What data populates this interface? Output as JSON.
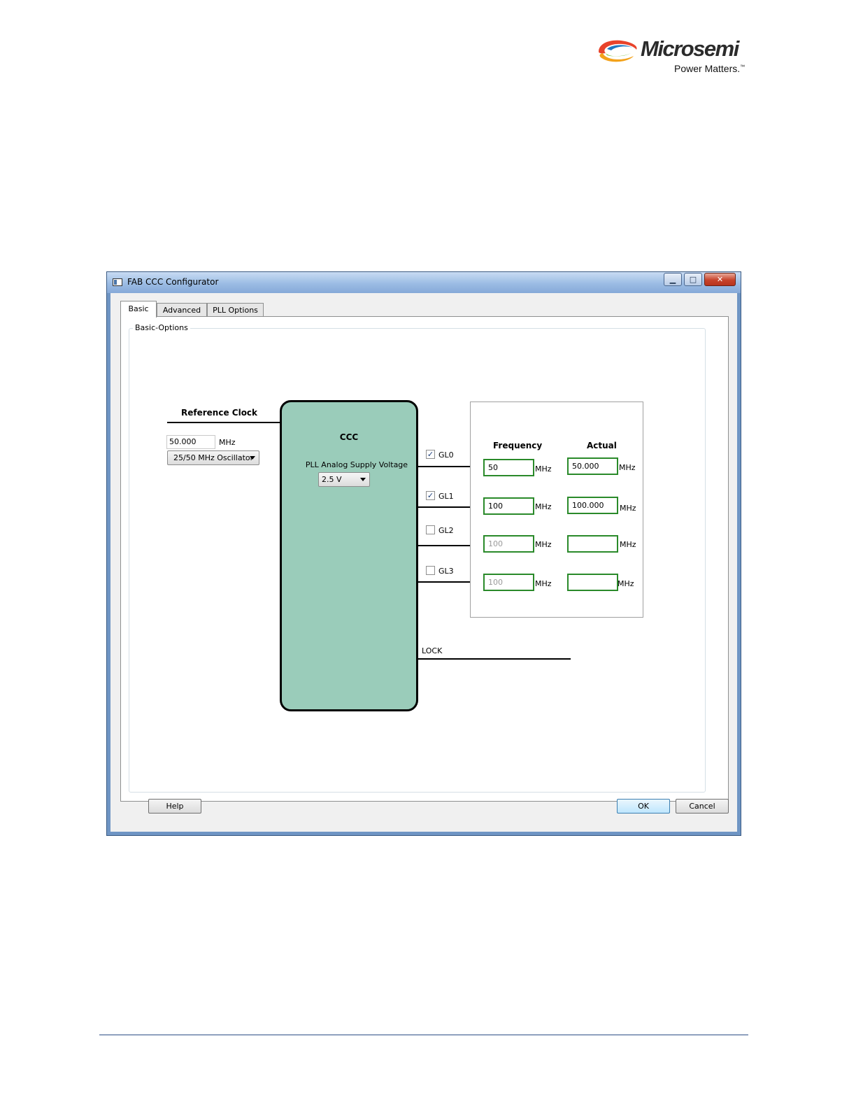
{
  "logo": {
    "brand": "Microsemi",
    "tagline": "Power Matters.",
    "trademark": "™"
  },
  "window": {
    "title": "FAB CCC Configurator",
    "controls": {
      "minimize": "▁",
      "maximize": "□",
      "close": "✕"
    }
  },
  "tabs": [
    "Basic",
    "Advanced",
    "PLL Options"
  ],
  "group": {
    "legend": "Basic-Options"
  },
  "reference_clock": {
    "label": "Reference Clock",
    "value": "50.000",
    "unit": "MHz",
    "source": "25/50 MHz Oscillator"
  },
  "ccc": {
    "title": "CCC",
    "pll_voltage_label": "PLL Analog Supply Voltage",
    "pll_voltage_value": "2.5 V"
  },
  "outputs": {
    "frequency_header": "Frequency",
    "actual_header": "Actual",
    "rows": [
      {
        "name": "GL0",
        "checked": true,
        "check_mark": "✓",
        "frequency": "50",
        "actual": "50.000",
        "unit": "MHz"
      },
      {
        "name": "GL1",
        "checked": true,
        "check_mark": "✓",
        "frequency": "100",
        "actual": "100.000",
        "unit": "MHz"
      },
      {
        "name": "GL2",
        "checked": false,
        "check_mark": "",
        "frequency": "100",
        "actual": "",
        "unit": "MHz"
      },
      {
        "name": "GL3",
        "checked": false,
        "check_mark": "",
        "frequency": "100",
        "actual": "",
        "unit": "MHz"
      }
    ]
  },
  "lock": {
    "label": "LOCK"
  },
  "buttons": {
    "help": "Help",
    "ok": "OK",
    "cancel": "Cancel"
  },
  "colors": {
    "ccc_fill": "#9accba",
    "field_border": "#2a8a2a",
    "titlebar": "#9bbce4"
  }
}
